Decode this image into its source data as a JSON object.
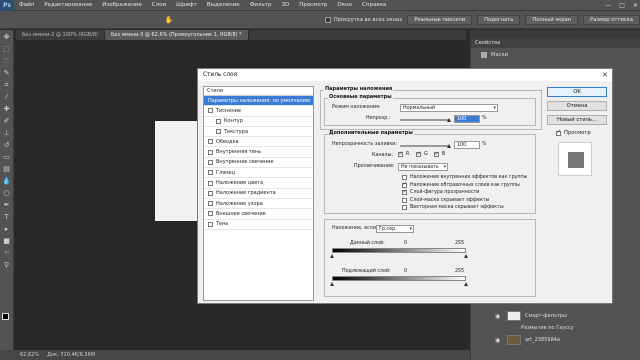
{
  "menubar": {
    "logo": "Ps",
    "items": [
      "Файл",
      "Редактирование",
      "Изображение",
      "Слои",
      "Шрифт",
      "Выделение",
      "Фильтр",
      "3D",
      "Просмотр",
      "Окно",
      "Справка"
    ],
    "controls": [
      "—",
      "□",
      "✕"
    ]
  },
  "options": {
    "check_label": "Прокрутка во всех окнах",
    "buttons": [
      "Реальные пиксели",
      "Подогнать",
      "Полный экран",
      "Размер оттиска"
    ]
  },
  "tabs": [
    {
      "label": "Без имени-2 @ 100% (RGB/8)",
      "active": false
    },
    {
      "label": "Без имени-3 @ 62,6% (Прямоугольник 1, RGB/8) *",
      "active": true
    }
  ],
  "panels": {
    "properties_title": "Свойства",
    "masks_label": "Маски",
    "layers": [
      {
        "name": "Смарт-фильтры",
        "thumb": "light"
      },
      {
        "name": "Размытие по Гауссу",
        "thumb": "none"
      },
      {
        "name": "art_2385984a",
        "thumb": "dark"
      }
    ]
  },
  "status": {
    "zoom": "62,62%",
    "doc": "Док: 710,4K/6,36M"
  },
  "dialog": {
    "title": "Стиль слоя",
    "close": "✕",
    "styles_header": "Стили",
    "styles": [
      {
        "label": "Параметры наложения: по умолчанию",
        "checkbox": false,
        "selected": true,
        "sub": false
      },
      {
        "label": "Тиснение",
        "checkbox": true,
        "selected": false,
        "sub": false
      },
      {
        "label": "Контур",
        "checkbox": true,
        "selected": false,
        "sub": true
      },
      {
        "label": "Текстура",
        "checkbox": true,
        "selected": false,
        "sub": true
      },
      {
        "label": "Обводка",
        "checkbox": true,
        "selected": false,
        "sub": false
      },
      {
        "label": "Внутренняя тень",
        "checkbox": true,
        "selected": false,
        "sub": false
      },
      {
        "label": "Внутреннее свечение",
        "checkbox": true,
        "selected": false,
        "sub": false
      },
      {
        "label": "Глянец",
        "checkbox": true,
        "selected": false,
        "sub": false
      },
      {
        "label": "Наложение цвета",
        "checkbox": true,
        "selected": false,
        "sub": false
      },
      {
        "label": "Наложение градиента",
        "checkbox": true,
        "selected": false,
        "sub": false
      },
      {
        "label": "Наложение узора",
        "checkbox": true,
        "selected": false,
        "sub": false
      },
      {
        "label": "Внешнее свечение",
        "checkbox": true,
        "selected": false,
        "sub": false
      },
      {
        "label": "Тень",
        "checkbox": true,
        "selected": false,
        "sub": false
      }
    ],
    "blend": {
      "section_title": "Параметры наложения",
      "basic_title": "Основные параметры",
      "mode_label": "Режим наложения:",
      "mode_value": "Нормальный",
      "opacity_label": "Непрозр.:",
      "opacity_value": "100",
      "percent": "%"
    },
    "advanced": {
      "title": "Дополнительные параметры",
      "fill_label": "Непрозрачность заливки:",
      "fill_value": "100",
      "channels_label": "Каналы:",
      "channels": [
        "R",
        "G",
        "B"
      ],
      "knockout_label": "Просвечивание:",
      "knockout_value": "Не показывать",
      "checks": [
        {
          "label": "Наложение внутренних эффектов как группы",
          "on": false
        },
        {
          "label": "Наложение обтравочных слоев как группы",
          "on": true
        },
        {
          "label": "Слой-фигура прозрачности",
          "on": true
        },
        {
          "label": "Слой-маска скрывает эффекты",
          "on": false
        },
        {
          "label": "Векторная маска скрывает эффекты",
          "on": false
        }
      ]
    },
    "blend_if": {
      "label": "Наложение, если:",
      "value": "Гр.сер.",
      "this_layer": "Данный слой:",
      "underlying": "Подлежащий слой:",
      "min": "0",
      "max": "255"
    },
    "buttons": {
      "ok": "OK",
      "cancel": "Отмена",
      "new_style": "Новый стиль...",
      "preview": "Просмотр"
    }
  }
}
